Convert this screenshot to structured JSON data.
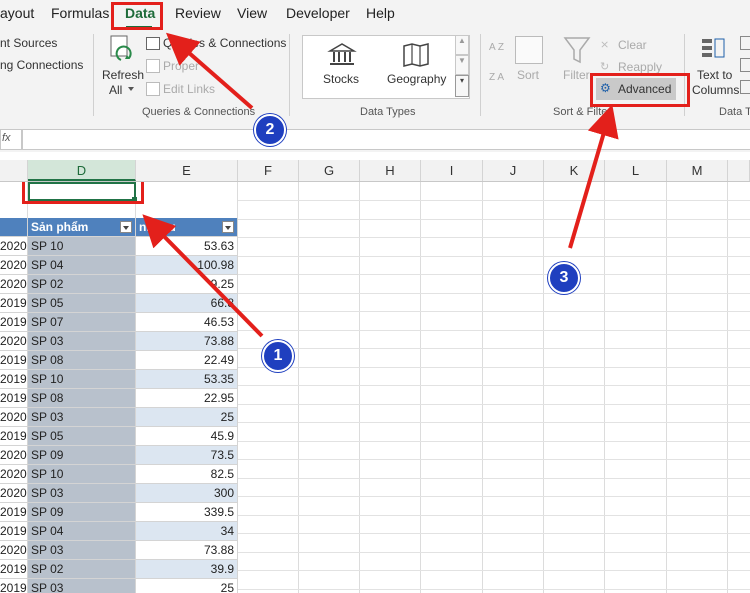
{
  "tabs": [
    {
      "label": "ayout",
      "active": false
    },
    {
      "label": "Formulas",
      "active": false
    },
    {
      "label": "Data",
      "active": true
    },
    {
      "label": "Review",
      "active": false
    },
    {
      "label": "View",
      "active": false
    },
    {
      "label": "Developer",
      "active": false
    },
    {
      "label": "Help",
      "active": false
    }
  ],
  "ribbon": {
    "get_data": {
      "sources_label": "nt Sources",
      "connections_label": "ng Connections"
    },
    "queries": {
      "refresh_label": "Refresh",
      "refresh_all_label": "All",
      "queries_connections_label": "Queries & Connections",
      "properties_label": "Proper",
      "edit_links_label": "Edit Links",
      "group_label": "Queries & Connections"
    },
    "data_types": {
      "stocks_label": "Stocks",
      "geography_label": "Geography",
      "group_label": "Data Types"
    },
    "sort_filter": {
      "az_label": "A Z",
      "za_label": "Z A",
      "sort_label": "Sort",
      "filter_label": "Filter",
      "clear_label": "Clear",
      "reapply_label": "Reapply",
      "advanced_label": "Advanced",
      "group_label": "Sort & Filter"
    },
    "data_tools": {
      "text_to_columns_line1": "Text to",
      "text_to_columns_line2": "Columns",
      "group_label": "Data To"
    }
  },
  "formula_bar": {
    "fx_label": "fx",
    "value": ""
  },
  "columns": [
    "D",
    "E",
    "F",
    "G",
    "H",
    "I",
    "J",
    "K",
    "L",
    "M"
  ],
  "table": {
    "headers": {
      "year": "",
      "product": "Sản phẩm",
      "revenue": "nh thu"
    },
    "rows": [
      {
        "year": "2020",
        "product": "SP 10",
        "revenue": "53.63"
      },
      {
        "year": "2020",
        "product": "SP 04",
        "revenue": "100.98"
      },
      {
        "year": "2020",
        "product": "SP 02",
        "revenue": "9.25"
      },
      {
        "year": "2019",
        "product": "SP 05",
        "revenue": "66.8"
      },
      {
        "year": "2019",
        "product": "SP 07",
        "revenue": "46.53"
      },
      {
        "year": "2020",
        "product": "SP 03",
        "revenue": "73.88"
      },
      {
        "year": "2019",
        "product": "SP 08",
        "revenue": "22.49"
      },
      {
        "year": "2019",
        "product": "SP 10",
        "revenue": "53.35"
      },
      {
        "year": "2019",
        "product": "SP 08",
        "revenue": "22.95"
      },
      {
        "year": "2020",
        "product": "SP 03",
        "revenue": "25"
      },
      {
        "year": "2019",
        "product": "SP 05",
        "revenue": "45.9"
      },
      {
        "year": "2020",
        "product": "SP 09",
        "revenue": "73.5"
      },
      {
        "year": "2020",
        "product": "SP 10",
        "revenue": "82.5"
      },
      {
        "year": "2020",
        "product": "SP 03",
        "revenue": "300"
      },
      {
        "year": "2019",
        "product": "SP 09",
        "revenue": "339.5"
      },
      {
        "year": "2019",
        "product": "SP 04",
        "revenue": "34"
      },
      {
        "year": "2020",
        "product": "SP 03",
        "revenue": "73.88"
      },
      {
        "year": "2019",
        "product": "SP 02",
        "revenue": "39.9"
      },
      {
        "year": "2019",
        "product": "SP 03",
        "revenue": "25"
      }
    ]
  },
  "annotations": {
    "step1": "1",
    "step2": "2",
    "step3": "3"
  },
  "colors": {
    "accent": "#1e6b3a",
    "annotation_red": "#e3201b",
    "badge_blue": "#1f3fbf",
    "table_header": "#4f81bd"
  }
}
